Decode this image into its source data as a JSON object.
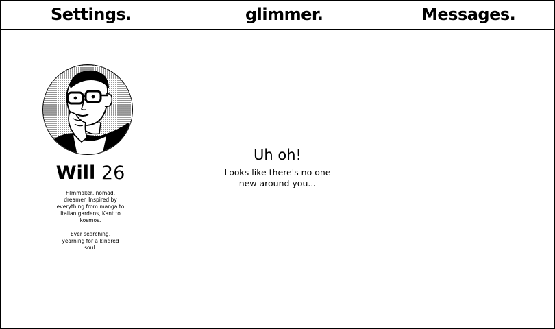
{
  "nav": {
    "settings_label": "Settings.",
    "logo_label": "glimmer.",
    "messages_label": "Messages."
  },
  "profile": {
    "name": "Will",
    "age": "26",
    "avatar_icon": "profile-portrait",
    "bio_paragraph_1": "Filmmaker, nomad, dreamer. Inspired by everything from manga to Italian gardens, Kant to kosmos.",
    "bio_paragraph_2": "Ever searching, yearning for a kindred soul."
  },
  "empty_state": {
    "title": "Uh oh!",
    "message": "Looks like there's no one new around you..."
  }
}
